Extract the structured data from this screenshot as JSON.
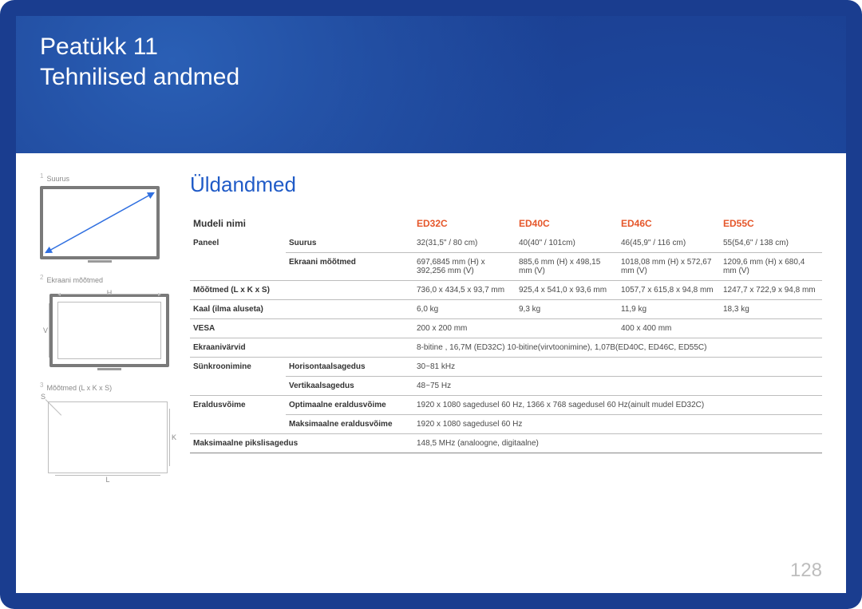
{
  "header": {
    "chapter_label": "Peatükk 11",
    "title": "Tehnilised andmed"
  },
  "sidebar": {
    "notes": [
      {
        "num": "1",
        "label": "Suurus"
      },
      {
        "num": "2",
        "label": "Ekraani mõõtmed",
        "h": "H",
        "v": "V"
      },
      {
        "num": "3",
        "label": "Mõõtmed (L x K x S)",
        "s": "S",
        "k": "K",
        "l": "L"
      }
    ]
  },
  "main": {
    "section_title": "Üldandmed",
    "columns": {
      "model": "Mudeli nimi",
      "ed32": "ED32C",
      "ed40": "ED40C",
      "ed46": "ED46C",
      "ed55": "ED55C"
    },
    "rows": {
      "paneel": "Paneel",
      "suurus": "Suurus",
      "suurus_v": {
        "ed32": "32(31,5\" / 80 cm)",
        "ed40": "40(40\" / 101cm)",
        "ed46": "46(45,9\" / 116 cm)",
        "ed55": "55(54,6\" / 138 cm)"
      },
      "ekraani": "Ekraani mõõtmed",
      "ekraani_v": {
        "ed32": "697,6845 mm (H) x 392,256 mm (V)",
        "ed40": "885,6 mm (H) x 498,15 mm (V)",
        "ed46": "1018,08 mm (H) x 572,67 mm (V)",
        "ed55": "1209,6 mm (H) x 680,4 mm (V)"
      },
      "mootmed": "Mõõtmed (L x K x S)",
      "mootmed_v": {
        "ed32": "736,0 x 434,5 x 93,7 mm",
        "ed40": "925,4 x 541,0 x 93,6 mm",
        "ed46": "1057,7 x 615,8 x 94,8 mm",
        "ed55": "1247,7 x 722,9 x 94,8 mm"
      },
      "kaal": "Kaal (ilma aluseta)",
      "kaal_v": {
        "ed32": "6,0 kg",
        "ed40": "9,3 kg",
        "ed46": "11,9 kg",
        "ed55": "18,3 kg"
      },
      "vesa": "VESA",
      "vesa_v": {
        "a": "200 x 200 mm",
        "b": "400 x 400 mm"
      },
      "varvid": "Ekraanivärvid",
      "varvid_v": "8-bitine , 16,7M (ED32C) 10-bitine(virvtoonimine), 1,07B(ED40C, ED46C, ED55C)",
      "sunkr": "Sünkroonimine",
      "horis": "Horisontaalsagedus",
      "horis_v": "30~81 kHz",
      "vert": "Vertikaalsagedus",
      "vert_v": "48~75 Hz",
      "erald": "Eraldusvõime",
      "opt": "Optimaalne eraldusvõime",
      "opt_v": "1920 x 1080 sagedusel 60 Hz, 1366 x 768 sagedusel 60 Hz(ainult mudel ED32C)",
      "maks": "Maksimaalne eraldusvõime",
      "maks_v": "1920 x 1080 sagedusel 60 Hz",
      "piksl": "Maksimaalne pikslisagedus",
      "piksl_v": "148,5 MHz (analoogne, digitaalne)"
    }
  },
  "page_number": "128"
}
